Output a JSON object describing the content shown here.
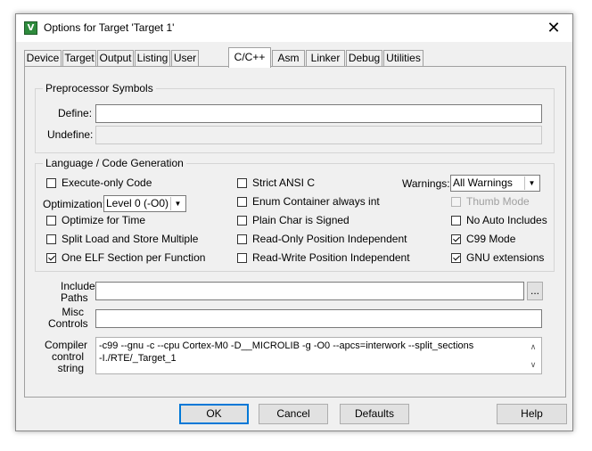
{
  "window": {
    "title": "Options for Target 'Target 1'",
    "close_glyph": "✕",
    "icon": "keil-uvision-icon"
  },
  "tabs": [
    {
      "label": "Device"
    },
    {
      "label": "Target"
    },
    {
      "label": "Output"
    },
    {
      "label": "Listing"
    },
    {
      "label": "User"
    },
    {
      "label": "C/C++"
    },
    {
      "label": "Asm"
    },
    {
      "label": "Linker"
    },
    {
      "label": "Debug"
    },
    {
      "label": "Utilities"
    }
  ],
  "active_tab": "C/C++",
  "preprocessor": {
    "legend": "Preprocessor Symbols",
    "define_label": "Define:",
    "define_value": "",
    "undefine_label": "Undefine:",
    "undefine_value": ""
  },
  "codegen": {
    "legend": "Language / Code Generation",
    "execute_only": "Execute-only Code",
    "optimization_label": "Optimization:",
    "optimization_value": "Level 0 (-O0)",
    "optimize_time": "Optimize for Time",
    "split_load": "Split Load and Store Multiple",
    "one_elf": "One ELF Section per Function",
    "strict_ansi": "Strict ANSI C",
    "enum_container": "Enum Container always int",
    "plain_char": "Plain Char is Signed",
    "ro_pi": "Read-Only Position Independent",
    "rw_pi": "Read-Write Position Independent",
    "warnings_label": "Warnings:",
    "warnings_value": "All Warnings",
    "thumb_mode": "Thumb Mode",
    "no_auto_includes": "No Auto Includes",
    "c99_mode": "C99 Mode",
    "gnu_ext": "GNU extensions"
  },
  "include": {
    "paths_label_1": "Include",
    "paths_label_2": "Paths",
    "browse_label": "...",
    "misc_label_1": "Misc",
    "misc_label_2": "Controls",
    "compiler_label_1": "Compiler",
    "compiler_label_2": "control",
    "compiler_label_3": "string",
    "compiler_line_1": "-c99 --gnu -c --cpu Cortex-M0 -D__MICROLIB -g -O0 --apcs=interwork --split_sections",
    "compiler_line_2": "-I./RTE/_Target_1"
  },
  "buttons": {
    "ok": "OK",
    "cancel": "Cancel",
    "defaults": "Defaults",
    "help": "Help"
  }
}
